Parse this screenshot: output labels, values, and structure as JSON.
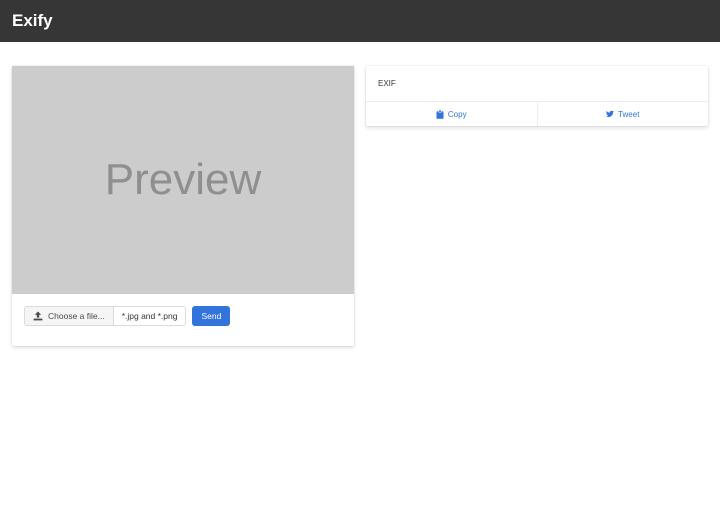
{
  "navbar": {
    "brand": "Exify",
    "background": "#363636"
  },
  "upload_card": {
    "preview_text": "Preview",
    "choose_file_label": "Choose a file...",
    "choose_file_icon": "upload-icon",
    "file_name_hint": "*.jpg and *.png",
    "send_label": "Send"
  },
  "exif_card": {
    "header": "EXIF",
    "copy_label": "Copy",
    "copy_icon": "clipboard-icon",
    "tweet_label": "Tweet",
    "tweet_icon": "twitter-icon"
  },
  "colors": {
    "primary": "#3273dc",
    "preview_bg": "#cccccc",
    "preview_text": "#8f8f8f"
  }
}
